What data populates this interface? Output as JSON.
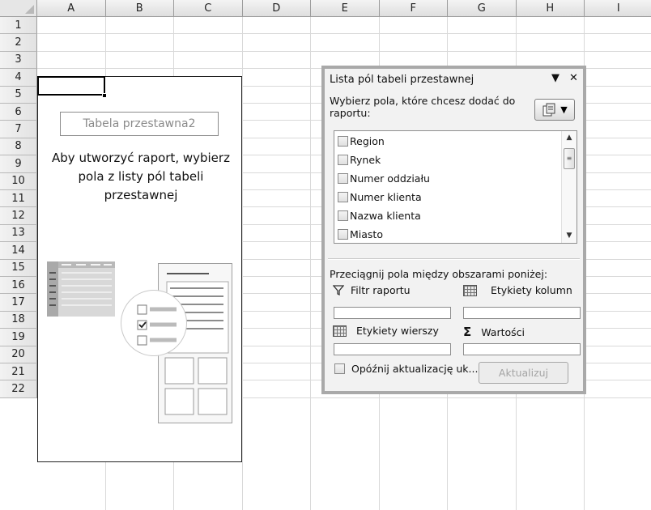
{
  "sheet": {
    "columns": [
      "A",
      "B",
      "C",
      "D",
      "E",
      "F",
      "G",
      "H",
      "I"
    ],
    "rows": [
      "1",
      "2",
      "3",
      "4",
      "5",
      "6",
      "7",
      "8",
      "9",
      "10",
      "11",
      "12",
      "13",
      "14",
      "15",
      "16",
      "17",
      "18",
      "19",
      "20",
      "21",
      "22"
    ]
  },
  "pivot_placeholder": {
    "name": "Tabela przestawna2",
    "instruction": "Aby utworzyć raport, wybierz pola z listy pól tabeli przestawnej"
  },
  "field_list_pane": {
    "title": "Lista pól tabeli przestawnej",
    "dropdown_glyph": "▼",
    "close_glyph": "✕",
    "choose_fields_prompt": "Wybierz pola, które chcesz dodać do raportu:",
    "fields": [
      {
        "label": "Region",
        "checked": false
      },
      {
        "label": "Rynek",
        "checked": false
      },
      {
        "label": "Numer oddziału",
        "checked": false
      },
      {
        "label": "Numer klienta",
        "checked": false
      },
      {
        "label": "Nazwa klienta",
        "checked": false
      },
      {
        "label": "Miasto",
        "checked": false
      }
    ],
    "drag_prompt": "Przeciągnij pola między obszarami poniżej:",
    "areas": {
      "report_filter": "Filtr raportu",
      "column_labels": "Etykiety kolumn",
      "row_labels": "Etykiety wierszy",
      "values": "Wartości"
    },
    "defer_update_label": "Opóźnij aktualizację uk...",
    "update_button": "Aktualizuj",
    "icons": {
      "filter": "funnel-icon",
      "columns": "grid-columns-icon",
      "rows": "grid-rows-icon",
      "values": "sigma-icon",
      "layout": "field-layout-icon"
    }
  }
}
